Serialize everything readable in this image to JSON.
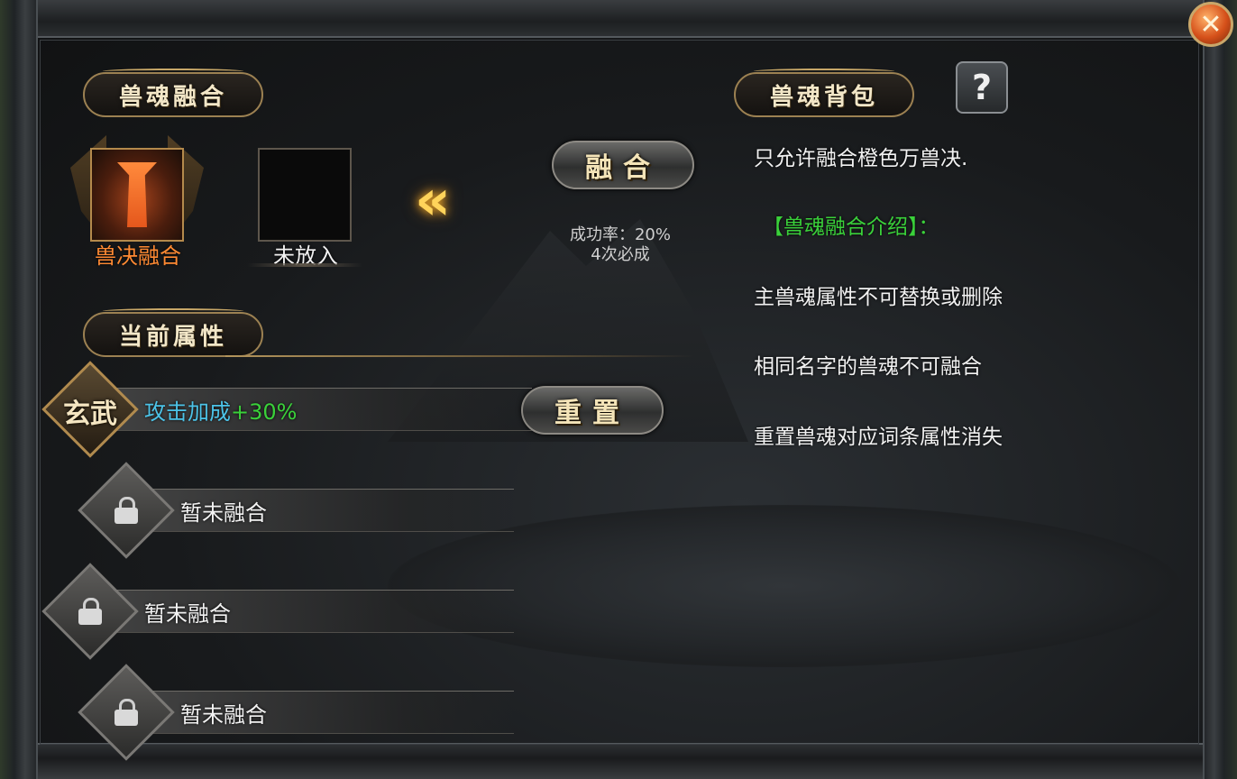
{
  "close_icon": "close-icon",
  "fusion_panel": {
    "title": "兽魂融合",
    "slot_primary_label": "兽决融合",
    "slot_secondary_label": "未放入",
    "fuse_button": "融合",
    "success_rate": "成功率：20%",
    "attempts": "4次必成"
  },
  "attributes_panel": {
    "title": "当前属性",
    "reset_button": "重置",
    "rows": [
      {
        "badge": "玄武",
        "name": "攻击加成",
        "value": "+30%",
        "locked": false
      },
      {
        "text": "暂未融合",
        "locked": true
      },
      {
        "text": "暂未融合",
        "locked": true
      },
      {
        "text": "暂未融合",
        "locked": true
      }
    ]
  },
  "bag_panel": {
    "title": "兽魂背包",
    "help_label": "?",
    "lines": [
      "只允许融合橙色万兽决.",
      "【兽魂融合介绍】：",
      "主兽魂属性不可替换或删除",
      "相同名字的兽魂不可融合",
      "重置兽魂对应词条属性消失"
    ]
  },
  "colors": {
    "accent_gold": "#b08a4e",
    "orange_label": "#ff8a33",
    "green_text": "#3ad13a",
    "cyan_text": "#4cc3e8"
  }
}
